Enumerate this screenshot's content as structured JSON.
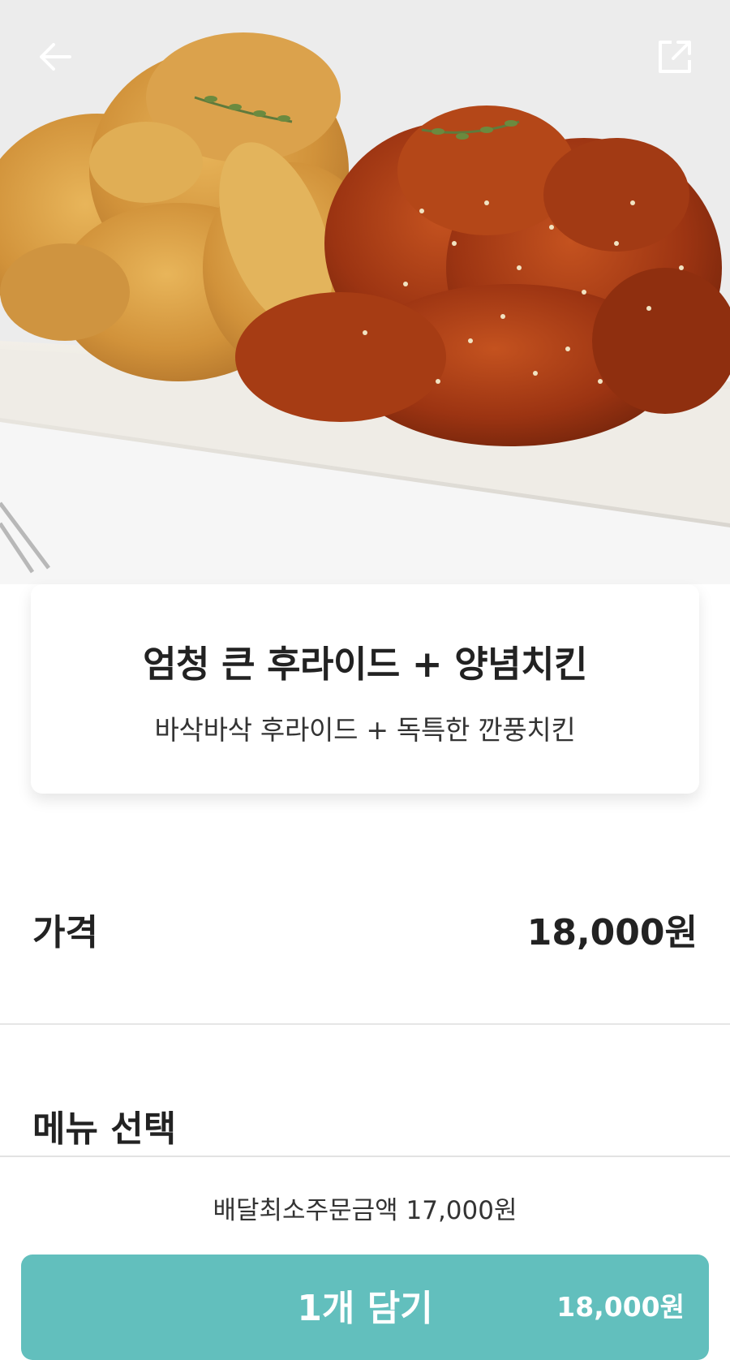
{
  "header": {
    "back_icon": "arrow-left-icon",
    "share_icon": "share-icon"
  },
  "menu": {
    "title": "엄청 큰 후라이드 + 양념치킨",
    "description": "바삭바삭 후라이드 + 독특한 깐풍치킨"
  },
  "price": {
    "label": "가격",
    "value": "18,000원"
  },
  "menu_select": {
    "label": "메뉴 선택"
  },
  "footer": {
    "min_order": "배달최소주문금액 17,000원",
    "add_button_label": "1개 담기",
    "add_button_price": "18,000원"
  },
  "colors": {
    "accent": "#62bfbd",
    "text": "#222222",
    "divider": "#e6e6e6"
  }
}
